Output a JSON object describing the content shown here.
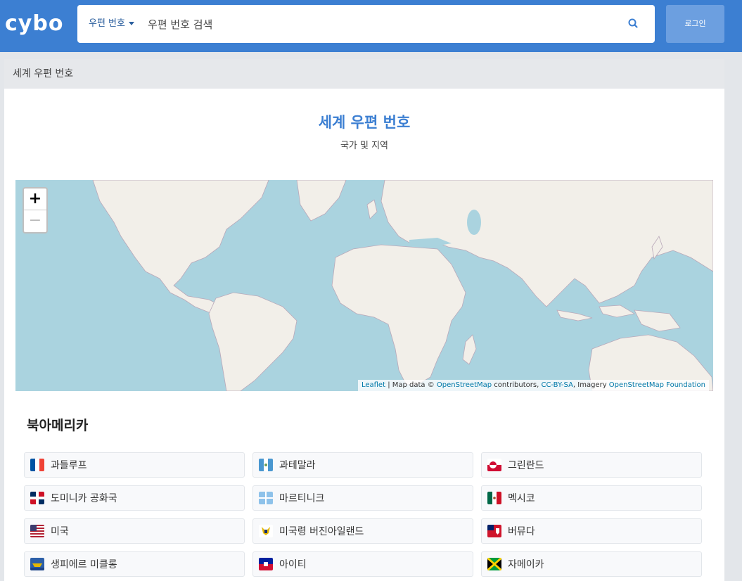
{
  "header": {
    "logo": "cybo",
    "scope_label": "우편 번호",
    "search_placeholder": "우편 번호 검색",
    "login_label": "로그인"
  },
  "breadcrumb": {
    "text": "세계 우편 번호"
  },
  "page": {
    "title": "세계 우편 번호",
    "subtitle": "국가 및 지역"
  },
  "map": {
    "zoom_in": "+",
    "zoom_out": "−",
    "attribution": {
      "leaflet": "Leaflet",
      "sep1": " | Map data © ",
      "osm": "OpenStreetMap",
      "contributors": " contributors, ",
      "license": "CC-BY-SA",
      "imagery": ", Imagery ",
      "foundation": "OpenStreetMap Foundation"
    },
    "colors": {
      "water": "#aad3df",
      "land": "#f2efe9",
      "border": "#b9a8b9"
    }
  },
  "region": {
    "title": "북아메리카",
    "countries": [
      {
        "name": "과들루프",
        "flag": "france-flag-icon"
      },
      {
        "name": "과테말라",
        "flag": "guatemala-flag-icon"
      },
      {
        "name": "그린란드",
        "flag": "greenland-flag-icon"
      },
      {
        "name": "도미니카 공화국",
        "flag": "dominican-republic-flag-icon"
      },
      {
        "name": "마르티니크",
        "flag": "martinique-flag-icon"
      },
      {
        "name": "멕시코",
        "flag": "mexico-flag-icon"
      },
      {
        "name": "미국",
        "flag": "usa-flag-icon"
      },
      {
        "name": "미국령 버진아일랜드",
        "flag": "us-virgin-islands-flag-icon"
      },
      {
        "name": "버뮤다",
        "flag": "bermuda-flag-icon"
      },
      {
        "name": "생피에르 미클롱",
        "flag": "saint-pierre-miquelon-flag-icon"
      },
      {
        "name": "아이티",
        "flag": "haiti-flag-icon"
      },
      {
        "name": "자메이카",
        "flag": "jamaica-flag-icon"
      }
    ]
  }
}
